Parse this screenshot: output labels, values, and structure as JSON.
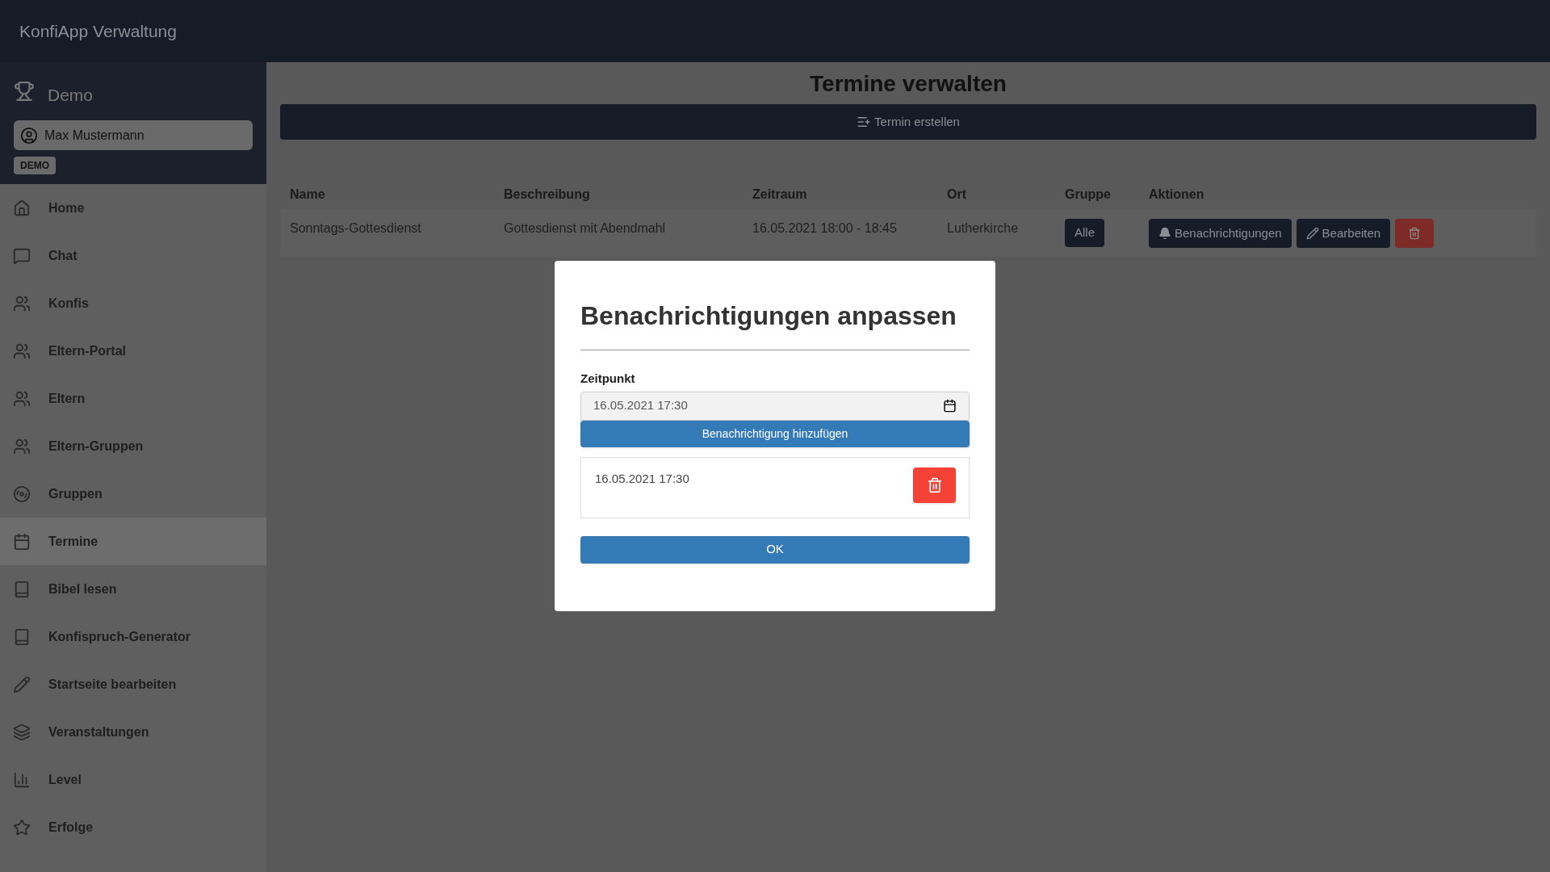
{
  "app_title": "KonfiApp Verwaltung",
  "sidebar": {
    "org": "Demo",
    "user": "Max Mustermann",
    "badge": "DEMO",
    "items": [
      {
        "label": "Home",
        "kind": "home",
        "selected": false
      },
      {
        "label": "Chat",
        "kind": "chat",
        "selected": false
      },
      {
        "label": "Konfis",
        "kind": "people",
        "selected": false
      },
      {
        "label": "Eltern-Portal",
        "kind": "people",
        "selected": false
      },
      {
        "label": "Eltern",
        "kind": "people",
        "selected": false
      },
      {
        "label": "Eltern-Gruppen",
        "kind": "people",
        "selected": false
      },
      {
        "label": "Gruppen",
        "kind": "groups",
        "selected": false
      },
      {
        "label": "Termine",
        "kind": "calendar",
        "selected": true
      },
      {
        "label": "Bibel lesen",
        "kind": "book",
        "selected": false
      },
      {
        "label": "Konfispruch-Generator",
        "kind": "book",
        "selected": false
      },
      {
        "label": "Startseite bearbeiten",
        "kind": "pencil",
        "selected": false
      },
      {
        "label": "Veranstaltungen",
        "kind": "layers",
        "selected": false
      },
      {
        "label": "Level",
        "kind": "chart",
        "selected": false
      },
      {
        "label": "Erfolge",
        "kind": "star",
        "selected": false
      }
    ]
  },
  "page": {
    "title": "Termine verwalten",
    "create_button": "Termin erstellen",
    "table": {
      "columns": [
        "Name",
        "Beschreibung",
        "Zeitraum",
        "Ort",
        "Gruppe",
        "Aktionen"
      ],
      "rows": [
        {
          "name": "Sonntags-Gottesdienst",
          "description": "Gottesdienst mit Abendmahl",
          "period": "16.05.2021 18:00 - 18:45",
          "place": "Lutherkirche",
          "group": "Alle",
          "notify_button": "Benachrichtigungen",
          "edit_button": "Bearbeiten"
        }
      ]
    }
  },
  "dialog": {
    "title": "Benachrichtigungen anpassen",
    "field_label": "Zeitpunkt",
    "field_value": "16.05.2021 17:30",
    "add_button": "Benachrichtigung hinzufügen",
    "notifications": [
      "16.05.2021 17:30"
    ],
    "ok_button": "OK"
  }
}
